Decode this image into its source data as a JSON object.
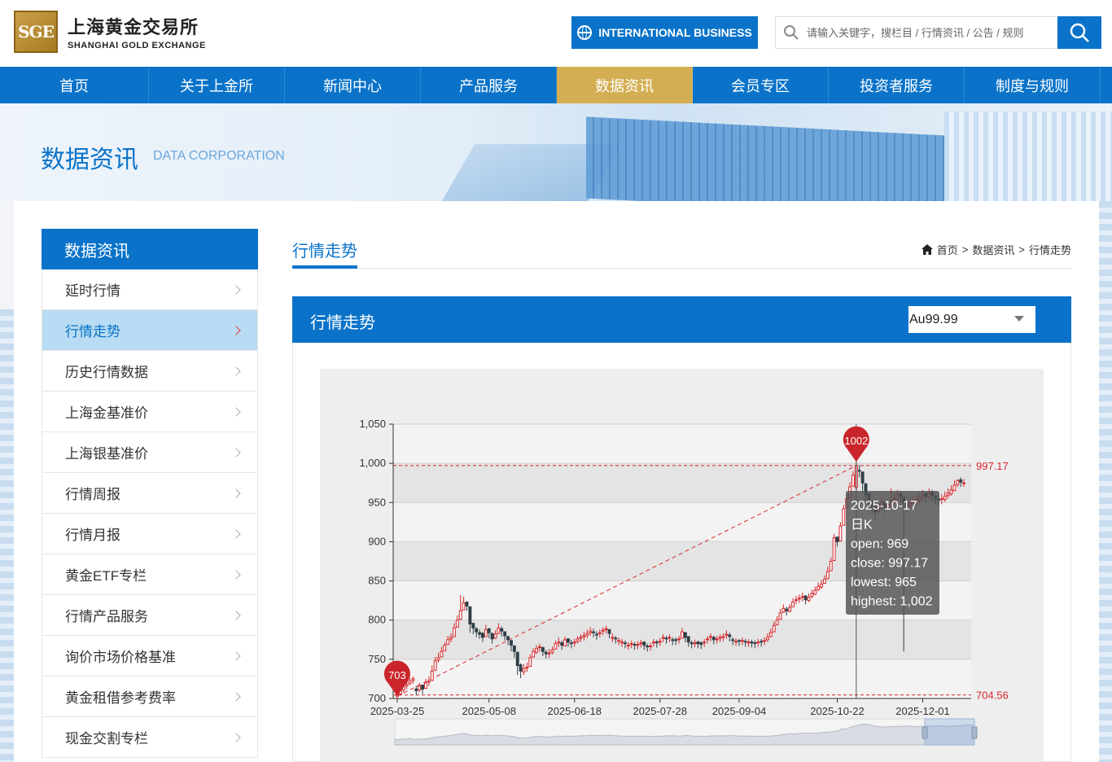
{
  "header": {
    "logo_mark": "SGE",
    "logo_cn": "上海黄金交易所",
    "logo_en": "SHANGHAI GOLD EXCHANGE",
    "intl_label": "INTERNATIONAL BUSINESS",
    "search_placeholder": "请输入关键字，搜栏目 / 行情资讯 / 公告 / 规则"
  },
  "nav": [
    "首页",
    "关于上金所",
    "新闻中心",
    "产品服务",
    "数据资讯",
    "会员专区",
    "投资者服务",
    "制度与规则"
  ],
  "nav_active": 4,
  "banner": {
    "title": "数据资讯",
    "subtitle": "DATA CORPORATION"
  },
  "sidebar": {
    "title": "数据资讯",
    "items": [
      "延时行情",
      "行情走势",
      "历史行情数据",
      "上海金基准价",
      "上海银基准价",
      "行情周报",
      "行情月报",
      "黄金ETF专栏",
      "行情产品服务",
      "询价市场价格基准",
      "黄金租借参考费率",
      "现金交割专栏"
    ],
    "active": 1
  },
  "main": {
    "title": "行情走势",
    "breadcrumb": [
      "首页",
      "数据资讯",
      "行情走势"
    ],
    "panel_title": "行情走势",
    "select_value": "Au99.99"
  },
  "colors": {
    "brand_blue": "#0a73c9",
    "nav_active": "#d3ae52",
    "up": "#d7262b",
    "down": "#2f3e46",
    "sidebar_active": "#b8dcf3"
  },
  "chart_data": {
    "type": "candlestick",
    "y_ticks": [
      "700",
      "750",
      "800",
      "850",
      "900",
      "950",
      "1,000",
      "1,050"
    ],
    "ylim": [
      700,
      1050
    ],
    "x_ticks": [
      "2025-03-25",
      "2025-05-08",
      "2025-06-18",
      "2025-07-28",
      "2025-09-04",
      "2025-10-22",
      "2025-12-01"
    ],
    "markline_max": "997.17",
    "markline_min": "704.56",
    "markpoint_max": "1002",
    "markpoint_min": "703",
    "tooltip": {
      "date": "2025-10-17",
      "label": "日K",
      "open": "open: 969",
      "close": "close: 997.17",
      "lowest": "lowest: 965",
      "highest": "highest: 1,002"
    },
    "closes": [
      705,
      710,
      715,
      718,
      722,
      725,
      710,
      716,
      712,
      720,
      722,
      735,
      748,
      752,
      760,
      768,
      775,
      778,
      790,
      800,
      812,
      822,
      818,
      795,
      790,
      785,
      782,
      778,
      788,
      784,
      776,
      782,
      790,
      786,
      780,
      775,
      768,
      760,
      742,
      735,
      738,
      740,
      752,
      760,
      764,
      766,
      760,
      757,
      758,
      762,
      770,
      772,
      768,
      775,
      772,
      770,
      772,
      776,
      778,
      780,
      783,
      786,
      784,
      781,
      784,
      787,
      789,
      783,
      778,
      776,
      774,
      772,
      770,
      768,
      770,
      768,
      769,
      771,
      768,
      766,
      767,
      772,
      771,
      773,
      778,
      776,
      778,
      774,
      774,
      776,
      785,
      778,
      772,
      770,
      771,
      770,
      769,
      772,
      776,
      779,
      775,
      776,
      778,
      779,
      782,
      779,
      774,
      773,
      773,
      774,
      772,
      772,
      771,
      770,
      772,
      772,
      774,
      778,
      784,
      793,
      800,
      809,
      815,
      812,
      816,
      823,
      826,
      828,
      830,
      826,
      829,
      834,
      838,
      843,
      846,
      852,
      862,
      875,
      905,
      900,
      920,
      942,
      955,
      970,
      985,
      997.17,
      990,
      975,
      960,
      952,
      945,
      938,
      945,
      950,
      944,
      948,
      952,
      955,
      960,
      958,
      949,
      945,
      950,
      952,
      954,
      957,
      960,
      958,
      962,
      959,
      955,
      953,
      955,
      958,
      962,
      966,
      972,
      978,
      976,
      975
    ],
    "highs": [
      710,
      713,
      720,
      723,
      726,
      728,
      716,
      720,
      718,
      725,
      728,
      742,
      753,
      758,
      766,
      772,
      780,
      783,
      796,
      806,
      832,
      830,
      824,
      806,
      796,
      791,
      788,
      785,
      794,
      790,
      784,
      787,
      796,
      792,
      786,
      780,
      774,
      768,
      754,
      745,
      744,
      746,
      756,
      764,
      768,
      770,
      766,
      762,
      763,
      766,
      774,
      778,
      774,
      779,
      777,
      775,
      776,
      780,
      782,
      785,
      788,
      791,
      789,
      786,
      788,
      791,
      793,
      788,
      783,
      780,
      778,
      776,
      774,
      772,
      774,
      772,
      773,
      775,
      773,
      770,
      771,
      776,
      775,
      777,
      782,
      780,
      782,
      778,
      778,
      780,
      790,
      785,
      776,
      774,
      775,
      774,
      773,
      776,
      780,
      783,
      780,
      780,
      782,
      783,
      787,
      784,
      778,
      777,
      776,
      778,
      776,
      776,
      775,
      774,
      776,
      776,
      778,
      783,
      789,
      798,
      805,
      814,
      820,
      817,
      820,
      828,
      831,
      833,
      835,
      831,
      834,
      839,
      843,
      848,
      851,
      857,
      868,
      880,
      910,
      906,
      925,
      947,
      960,
      976,
      990,
      1002,
      998,
      985,
      970,
      960,
      953,
      946,
      950,
      956,
      952,
      955,
      968,
      961,
      966,
      964,
      955,
      951,
      956,
      958,
      960,
      963,
      966,
      964,
      968,
      966,
      961,
      959,
      961,
      964,
      968,
      972,
      978,
      980,
      982,
      980
    ],
    "lows": [
      700,
      704,
      708,
      712,
      717,
      719,
      704,
      708,
      706,
      714,
      716,
      729,
      742,
      746,
      754,
      762,
      769,
      772,
      784,
      795,
      806,
      814,
      812,
      784,
      782,
      778,
      776,
      772,
      780,
      777,
      770,
      776,
      782,
      779,
      774,
      768,
      760,
      752,
      730,
      726,
      730,
      734,
      744,
      752,
      757,
      760,
      754,
      751,
      752,
      756,
      763,
      766,
      762,
      768,
      766,
      764,
      766,
      770,
      772,
      774,
      777,
      780,
      778,
      775,
      778,
      781,
      783,
      777,
      772,
      770,
      768,
      766,
      764,
      762,
      764,
      762,
      763,
      765,
      762,
      760,
      761,
      766,
      765,
      767,
      772,
      770,
      772,
      768,
      768,
      770,
      778,
      772,
      766,
      764,
      765,
      764,
      763,
      766,
      770,
      773,
      769,
      770,
      772,
      773,
      776,
      773,
      768,
      767,
      767,
      768,
      766,
      766,
      765,
      764,
      766,
      766,
      768,
      772,
      778,
      787,
      794,
      803,
      809,
      806,
      810,
      817,
      820,
      822,
      824,
      820,
      823,
      828,
      832,
      837,
      840,
      846,
      855,
      868,
      895,
      894,
      914,
      935,
      948,
      962,
      975,
      965,
      982,
      965,
      950,
      942,
      935,
      928,
      935,
      940,
      936,
      940,
      944,
      948,
      952,
      950,
      760,
      938,
      942,
      944,
      946,
      949,
      952,
      950,
      954,
      952,
      948,
      946,
      948,
      951,
      955,
      959,
      966,
      970,
      970,
      970
    ],
    "opens": [
      703,
      706,
      711,
      716,
      719,
      723,
      712,
      711,
      717,
      713,
      721,
      723,
      736,
      749,
      753,
      761,
      769,
      776,
      779,
      791,
      801,
      813,
      823,
      817,
      796,
      789,
      784,
      783,
      779,
      789,
      783,
      777,
      783,
      789,
      785,
      779,
      774,
      767,
      759,
      743,
      734,
      739,
      741,
      753,
      759,
      765,
      765,
      759,
      758,
      759,
      763,
      771,
      771,
      767,
      776,
      771,
      771,
      773,
      777,
      779,
      781,
      784,
      785,
      782,
      783,
      786,
      788,
      788,
      777,
      777,
      773,
      771,
      771,
      767,
      769,
      769,
      768,
      770,
      772,
      767,
      766,
      771,
      772,
      772,
      777,
      777,
      777,
      775,
      775,
      775,
      777,
      784,
      779,
      771,
      770,
      772,
      771,
      771,
      775,
      778,
      778,
      775,
      777,
      778,
      781,
      781,
      775,
      772,
      774,
      773,
      773,
      771,
      772,
      771,
      771,
      773,
      773,
      775,
      779,
      785,
      794,
      801,
      810,
      814,
      811,
      817,
      825,
      827,
      829,
      831,
      825,
      830,
      833,
      839,
      842,
      847,
      853,
      863,
      876,
      906,
      901,
      921,
      943,
      956,
      971,
      969,
      991,
      989,
      974,
      961,
      951,
      944,
      939,
      944,
      951,
      943,
      947,
      953,
      954,
      961,
      957,
      950,
      946,
      949,
      953,
      953,
      958,
      961,
      957,
      963,
      958,
      954,
      954,
      954,
      959,
      961,
      965,
      973,
      979,
      974
    ]
  }
}
